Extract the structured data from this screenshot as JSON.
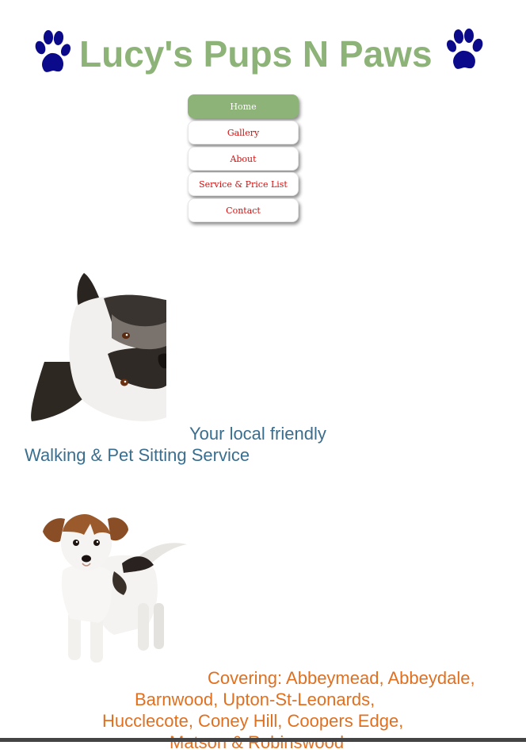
{
  "site": {
    "title": "Lucy's Pups N Paws",
    "brand_color": "#8db378",
    "paw_color": "#0a0a8a"
  },
  "nav": {
    "items": [
      {
        "label": "Home",
        "active": true
      },
      {
        "label": "Gallery",
        "active": false
      },
      {
        "label": "About",
        "active": false
      },
      {
        "label": "Service & Price List",
        "active": false
      },
      {
        "label": "Contact",
        "active": false
      }
    ],
    "active_color": "#8db378",
    "text_color": "#cc1111"
  },
  "intro": {
    "line1": "Your local friendly",
    "line2": "Walking & Pet Sitting Service",
    "color": "#3a6e8f"
  },
  "coverage": {
    "lines": [
      "Covering: Abbeymead, Abbeydale,",
      "Barnwood, Upton-St-Leonards,",
      "Hucclecote, Coney Hill, Coopers Edge,",
      "Matson & Robinswood"
    ],
    "color": "#e07020"
  },
  "icons": {
    "paw_left": "paw-print-icon",
    "paw_right": "paw-print-icon"
  }
}
